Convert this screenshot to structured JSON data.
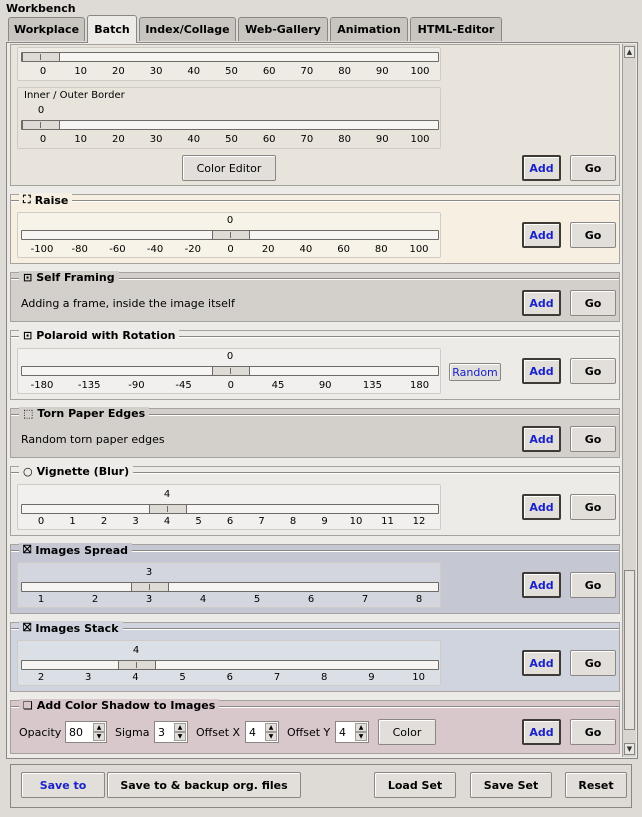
{
  "window": {
    "title": "Workbench"
  },
  "tabs": [
    "Workplace",
    "Batch",
    "Index/Collage",
    "Web-Gallery",
    "Animation",
    "HTML-Editor"
  ],
  "color_editor": {
    "ticks": [
      "0",
      "10",
      "20",
      "30",
      "40",
      "50",
      "60",
      "70",
      "80",
      "90",
      "100"
    ],
    "inner_outer_label": "Inner / Outer Border",
    "inner_outer_value": "0",
    "color_editor_label": "Color Editor"
  },
  "buttons": {
    "add": "Add",
    "go": "Go"
  },
  "raise": {
    "title": "Raise",
    "value": "0",
    "ticks": [
      "-100",
      "-80",
      "-60",
      "-40",
      "-20",
      "0",
      "20",
      "40",
      "60",
      "80",
      "100"
    ]
  },
  "self_framing": {
    "title": "Self Framing",
    "description": "Adding a frame, inside the image itself"
  },
  "polaroid": {
    "title": "Polaroid with Rotation",
    "value": "0",
    "ticks": [
      "-180",
      "-135",
      "-90",
      "-45",
      "0",
      "45",
      "90",
      "135",
      "180"
    ],
    "random_label": "Random"
  },
  "torn": {
    "title": "Torn Paper Edges",
    "description": "Random torn paper edges"
  },
  "vignette": {
    "title": "Vignette (Blur)",
    "value": "4",
    "ticks": [
      "0",
      "1",
      "2",
      "3",
      "4",
      "5",
      "6",
      "7",
      "8",
      "9",
      "10",
      "11",
      "12"
    ]
  },
  "spread": {
    "title": "Images Spread",
    "value": "3",
    "ticks": [
      "1",
      "2",
      "3",
      "4",
      "5",
      "6",
      "7",
      "8"
    ]
  },
  "stack": {
    "title": "Images Stack",
    "value": "4",
    "ticks": [
      "2",
      "3",
      "4",
      "5",
      "6",
      "7",
      "8",
      "9",
      "10"
    ]
  },
  "shadow": {
    "title": "Add Color Shadow to Images",
    "opacity_label": "Opacity",
    "opacity_value": "80",
    "sigma_label": "Sigma",
    "sigma_value": "3",
    "offset_x_label": "Offset X",
    "offset_x_value": "4",
    "offset_y_label": "Offset Y",
    "offset_y_value": "4",
    "color_label": "Color"
  },
  "bottom": {
    "save_to": "Save to",
    "save_backup": "Save to & backup org. files",
    "load_set": "Load Set",
    "save_set": "Save Set",
    "reset": "Reset"
  },
  "colors": {
    "raise_bg": "#f6efe2",
    "section_bg": "#e8e4dc",
    "grey_bg": "#d3d0cc",
    "spread_bg": "#c5c8d3",
    "stack_bg": "#cfd4de",
    "shadow_bg": "#d8c8cc",
    "add_text": "#1a22cc"
  }
}
